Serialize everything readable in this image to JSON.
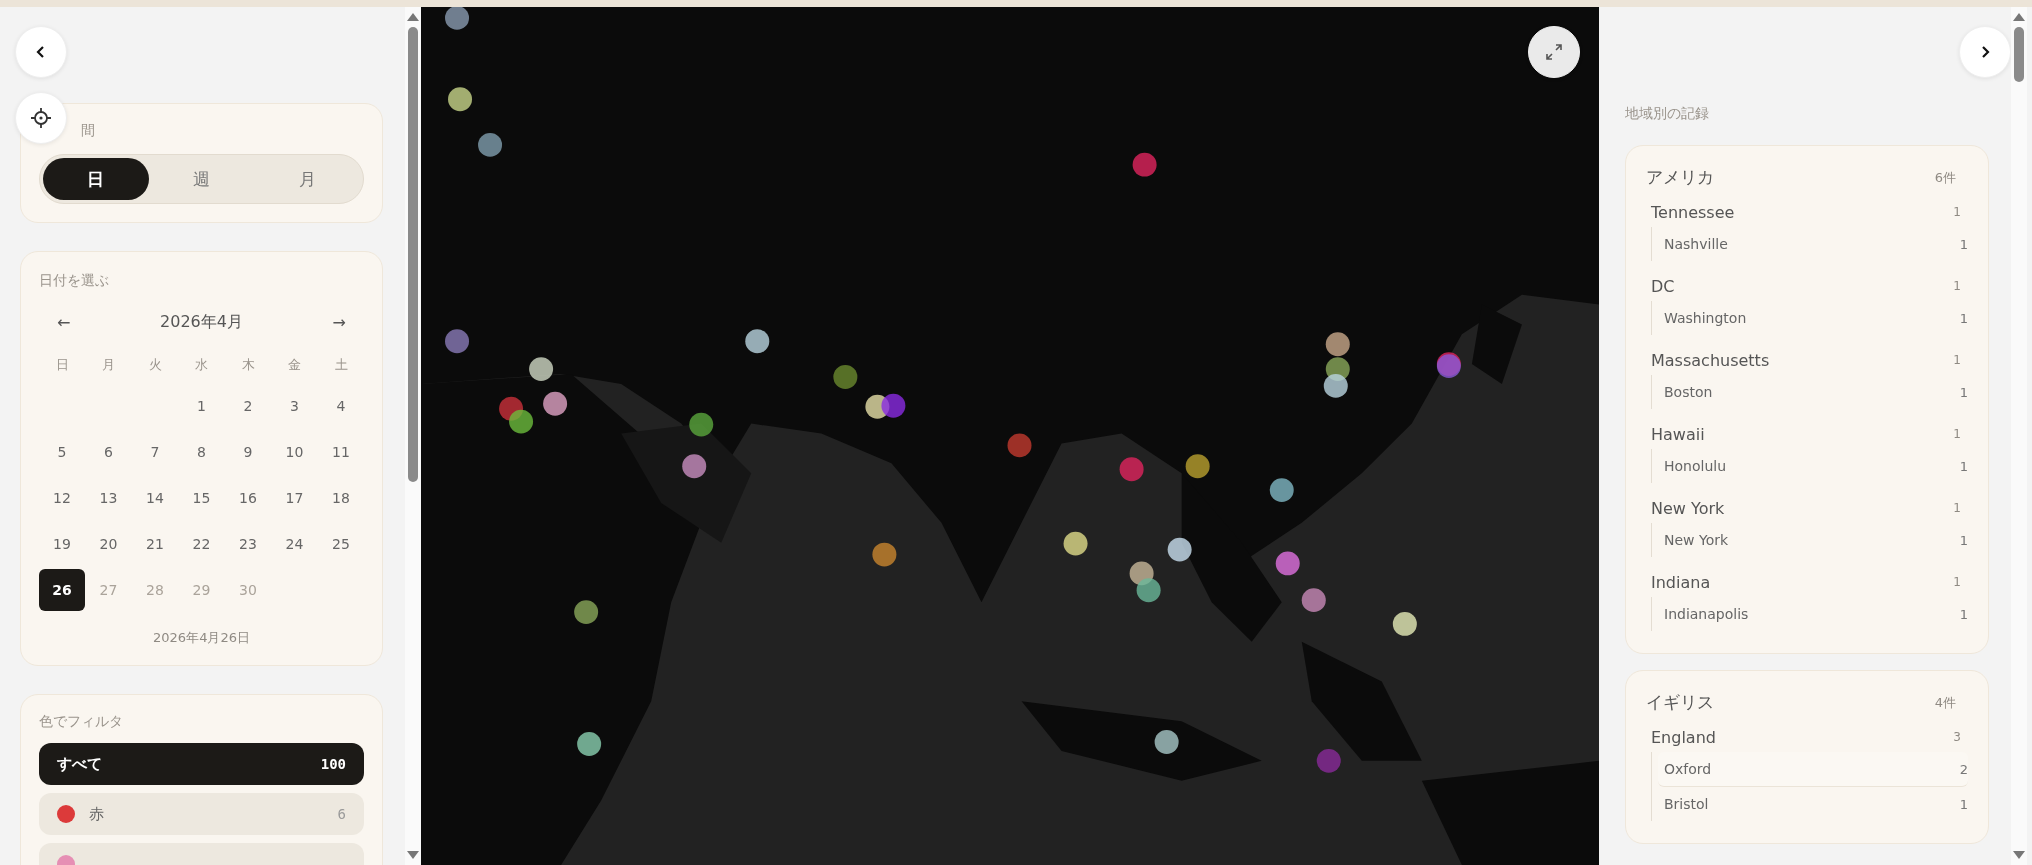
{
  "period": {
    "label": "間",
    "options": [
      {
        "label": "日",
        "selected": true
      },
      {
        "label": "週",
        "selected": false
      },
      {
        "label": "月",
        "selected": false
      }
    ]
  },
  "date_picker": {
    "title": "日付を選ぶ",
    "month": "2026年4月",
    "prev": "←",
    "next": "→",
    "weekdays": [
      "日",
      "月",
      "火",
      "水",
      "木",
      "金",
      "土"
    ],
    "days": [
      {
        "kind": "blank"
      },
      {
        "kind": "blank"
      },
      {
        "kind": "blank"
      },
      {
        "kind": "day",
        "label": "1",
        "selected": false,
        "disabled": false
      },
      {
        "kind": "day",
        "label": "2",
        "selected": false,
        "disabled": false
      },
      {
        "kind": "day",
        "label": "3",
        "selected": false,
        "disabled": false
      },
      {
        "kind": "day",
        "label": "4",
        "selected": false,
        "disabled": false
      },
      {
        "kind": "day",
        "label": "5",
        "selected": false,
        "disabled": false
      },
      {
        "kind": "day",
        "label": "6",
        "selected": false,
        "disabled": false
      },
      {
        "kind": "day",
        "label": "7",
        "selected": false,
        "disabled": false
      },
      {
        "kind": "day",
        "label": "8",
        "selected": false,
        "disabled": false
      },
      {
        "kind": "day",
        "label": "9",
        "selected": false,
        "disabled": false
      },
      {
        "kind": "day",
        "label": "10",
        "selected": false,
        "disabled": false
      },
      {
        "kind": "day",
        "label": "11",
        "selected": false,
        "disabled": false
      },
      {
        "kind": "day",
        "label": "12",
        "selected": false,
        "disabled": false
      },
      {
        "kind": "day",
        "label": "13",
        "selected": false,
        "disabled": false
      },
      {
        "kind": "day",
        "label": "14",
        "selected": false,
        "disabled": false
      },
      {
        "kind": "day",
        "label": "15",
        "selected": false,
        "disabled": false
      },
      {
        "kind": "day",
        "label": "16",
        "selected": false,
        "disabled": false
      },
      {
        "kind": "day",
        "label": "17",
        "selected": false,
        "disabled": false
      },
      {
        "kind": "day",
        "label": "18",
        "selected": false,
        "disabled": false
      },
      {
        "kind": "day",
        "label": "19",
        "selected": false,
        "disabled": false
      },
      {
        "kind": "day",
        "label": "20",
        "selected": false,
        "disabled": false
      },
      {
        "kind": "day",
        "label": "21",
        "selected": false,
        "disabled": false
      },
      {
        "kind": "day",
        "label": "22",
        "selected": false,
        "disabled": false
      },
      {
        "kind": "day",
        "label": "23",
        "selected": false,
        "disabled": false
      },
      {
        "kind": "day",
        "label": "24",
        "selected": false,
        "disabled": false
      },
      {
        "kind": "day",
        "label": "25",
        "selected": false,
        "disabled": false
      },
      {
        "kind": "day",
        "label": "26",
        "selected": true,
        "disabled": false
      },
      {
        "kind": "day",
        "label": "27",
        "selected": false,
        "disabled": true
      },
      {
        "kind": "day",
        "label": "28",
        "selected": false,
        "disabled": true
      },
      {
        "kind": "day",
        "label": "29",
        "selected": false,
        "disabled": true
      },
      {
        "kind": "day",
        "label": "30",
        "selected": false,
        "disabled": true
      }
    ],
    "selected_date": "2026年4月26日"
  },
  "color_filter": {
    "title": "色でフィルタ",
    "items": [
      {
        "label": "すべて",
        "count": "100",
        "selected": true
      },
      {
        "label": "赤",
        "count": "6",
        "color": "#dc3a3a",
        "selected": false
      },
      {
        "color": "#e68fb4",
        "selected": false
      }
    ]
  },
  "records": {
    "title": "地域別の記録",
    "countries": [
      {
        "name": "アメリカ",
        "count": "6件",
        "children": [
          {
            "name": "Tennessee",
            "count": "1",
            "children": [
              {
                "name": "Nashville",
                "count": "1",
                "selected": false
              }
            ]
          },
          {
            "name": "DC",
            "count": "1",
            "children": [
              {
                "name": "Washington",
                "count": "1",
                "selected": false
              }
            ]
          },
          {
            "name": "Massachusetts",
            "count": "1",
            "children": [
              {
                "name": "Boston",
                "count": "1",
                "selected": false
              }
            ]
          },
          {
            "name": "Hawaii",
            "count": "1",
            "children": [
              {
                "name": "Honolulu",
                "count": "1",
                "selected": false
              }
            ]
          },
          {
            "name": "New York",
            "count": "1",
            "children": [
              {
                "name": "New York",
                "count": "1",
                "selected": false
              }
            ]
          },
          {
            "name": "Indiana",
            "count": "1",
            "children": [
              {
                "name": "Indianapolis",
                "count": "1",
                "selected": false
              }
            ]
          }
        ]
      },
      {
        "name": "イギリス",
        "count": "4件",
        "children": [
          {
            "name": "England",
            "count": "3",
            "children": [
              {
                "name": "Oxford",
                "count": "2",
                "selected": true
              },
              {
                "name": "Bristol",
                "count": "1",
                "selected": false
              }
            ]
          }
        ]
      }
    ]
  }
}
